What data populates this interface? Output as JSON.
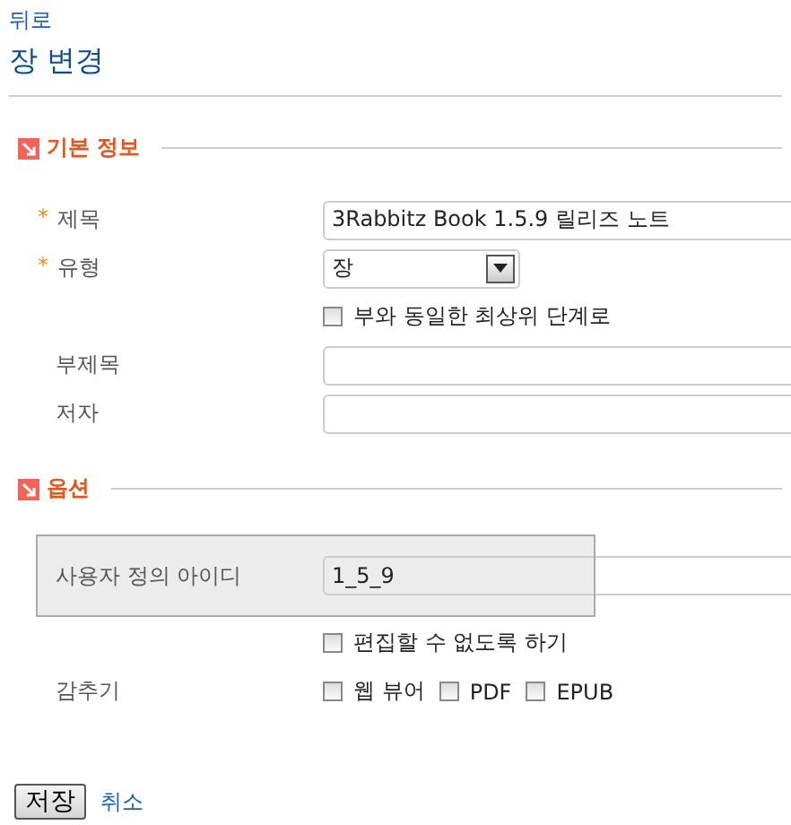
{
  "back_link": "뒤로",
  "page_title": "장 변경",
  "sections": [
    {
      "title": "기본 정보",
      "rows": [
        {
          "kind": "text",
          "marker": "*",
          "label": "제목",
          "value": "3Rabbitz Book 1.5.9 릴리즈 노트",
          "highlighted": false
        },
        {
          "kind": "select",
          "marker": "*",
          "label": "유형",
          "value": "장",
          "highlighted": false
        },
        {
          "kind": "checks",
          "options": [
            {
              "label": "부와 동일한 최상위 단계로",
              "checked": false
            }
          ],
          "highlighted": false
        },
        {
          "kind": "text",
          "label": "부제목",
          "highlighted": false
        },
        {
          "kind": "text",
          "label": "저자",
          "highlighted": false
        }
      ]
    },
    {
      "title": "옵션",
      "rows": [
        {
          "kind": "text",
          "label": "사용자 정의 아이디",
          "value": "1_5_9",
          "highlighted": true
        },
        {
          "kind": "checks",
          "options": [
            {
              "label": "편집할 수 없도록 하기",
              "checked": false
            }
          ],
          "highlighted": false
        },
        {
          "kind": "checks",
          "label": "감추기",
          "options": [
            {
              "label": "웹 뷰어",
              "checked": false
            },
            {
              "label": "PDF",
              "checked": false
            },
            {
              "label": "EPUB",
              "checked": false
            }
          ],
          "highlighted": false
        }
      ]
    }
  ],
  "actions": {
    "save": "저장",
    "cancel": "취소"
  }
}
